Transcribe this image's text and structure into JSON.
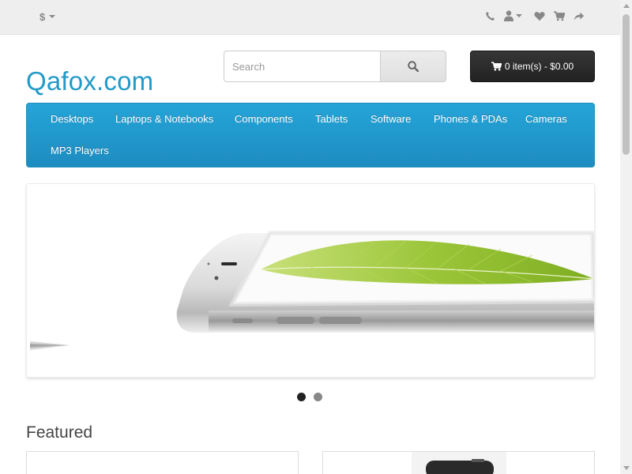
{
  "top_bar": {
    "currency_symbol": "$",
    "icons": [
      "phone-icon",
      "user-icon",
      "heart-icon",
      "cart-icon",
      "share-icon"
    ]
  },
  "header": {
    "logo_text": "Qafox.com",
    "search": {
      "placeholder": "Search",
      "value": ""
    },
    "cart": {
      "label": "0 item(s) - $0.00"
    }
  },
  "menu": {
    "items": [
      "Desktops",
      "Laptops & Notebooks",
      "Components",
      "Tablets",
      "Software",
      "Phones & PDAs",
      "Cameras",
      "MP3 Players"
    ]
  },
  "slideshow": {
    "slide_count": 2,
    "active_slide": 1
  },
  "featured": {
    "title": "Featured"
  },
  "colors": {
    "brand": "#229ac8",
    "menu_top": "#24a5d8",
    "menu_bottom": "#1e8cc0",
    "cart_button": "#2b2b2b",
    "top_bar": "#eeeeee"
  }
}
